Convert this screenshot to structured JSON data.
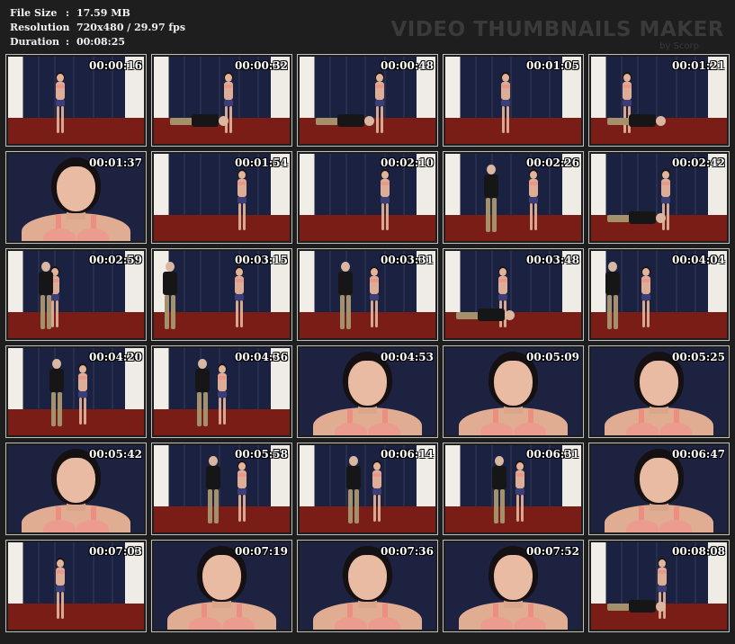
{
  "info": {
    "file_size_label": "File Size",
    "file_size_value": "17.59 MB",
    "resolution_label": "Resolution",
    "resolution_value": "720x480 / 29.97 fps",
    "duration_label": "Duration",
    "duration_value": "00:08:25",
    "separator": ":"
  },
  "brand": {
    "title": "VIDEO THUMBNAILS MAKER",
    "subtitle": "by Scorp"
  },
  "thumbnails": [
    {
      "time": "00:00:16",
      "scene": "studio"
    },
    {
      "time": "00:00:32",
      "scene": "studio"
    },
    {
      "time": "00:00:48",
      "scene": "studio"
    },
    {
      "time": "00:01:05",
      "scene": "studio"
    },
    {
      "time": "00:01:21",
      "scene": "studio"
    },
    {
      "time": "00:01:37",
      "scene": "portrait"
    },
    {
      "time": "00:01:54",
      "scene": "studio"
    },
    {
      "time": "00:02:10",
      "scene": "studio"
    },
    {
      "time": "00:02:26",
      "scene": "studio"
    },
    {
      "time": "00:02:42",
      "scene": "studio"
    },
    {
      "time": "00:02:59",
      "scene": "studio"
    },
    {
      "time": "00:03:15",
      "scene": "studio"
    },
    {
      "time": "00:03:31",
      "scene": "studio"
    },
    {
      "time": "00:03:48",
      "scene": "studio"
    },
    {
      "time": "00:04:04",
      "scene": "studio"
    },
    {
      "time": "00:04:20",
      "scene": "studio"
    },
    {
      "time": "00:04:36",
      "scene": "studio"
    },
    {
      "time": "00:04:53",
      "scene": "portrait"
    },
    {
      "time": "00:05:09",
      "scene": "portrait"
    },
    {
      "time": "00:05:25",
      "scene": "portrait"
    },
    {
      "time": "00:05:42",
      "scene": "portrait"
    },
    {
      "time": "00:05:58",
      "scene": "studio"
    },
    {
      "time": "00:06:14",
      "scene": "studio"
    },
    {
      "time": "00:06:31",
      "scene": "studio"
    },
    {
      "time": "00:06:47",
      "scene": "portrait"
    },
    {
      "time": "00:07:03",
      "scene": "studio"
    },
    {
      "time": "00:07:19",
      "scene": "portrait"
    },
    {
      "time": "00:07:36",
      "scene": "portrait"
    },
    {
      "time": "00:07:52",
      "scene": "portrait"
    },
    {
      "time": "00:08:08",
      "scene": "studio"
    }
  ]
}
